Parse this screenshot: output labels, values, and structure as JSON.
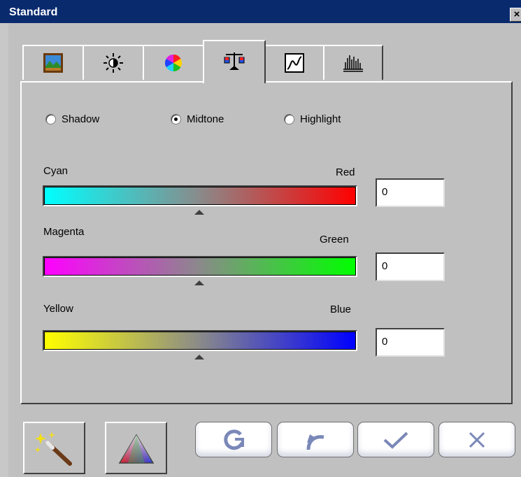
{
  "window": {
    "title": "Standard",
    "close_glyph": "×"
  },
  "tabs": [
    {
      "name": "image-tab",
      "icon": "landscape-picture-icon",
      "active": false
    },
    {
      "name": "brightness-tab",
      "icon": "sun-icon",
      "active": false
    },
    {
      "name": "color-wheel-tab",
      "icon": "color-wheel-icon",
      "active": false
    },
    {
      "name": "color-balance-tab",
      "icon": "balance-scale-icon",
      "active": true
    },
    {
      "name": "curves-tab",
      "icon": "curve-icon",
      "active": false
    },
    {
      "name": "histogram-tab",
      "icon": "histogram-icon",
      "active": false
    }
  ],
  "tone": {
    "options": [
      "Shadow",
      "Midtone",
      "Highlight"
    ],
    "selected": "Midtone"
  },
  "sliders": [
    {
      "left_label": "Cyan",
      "right_label": "Red",
      "value": "0",
      "left_color": "#00ffff",
      "right_color": "#ff0000"
    },
    {
      "left_label": "Magenta",
      "right_label": "Green",
      "value": "0",
      "left_color": "#ff00ff",
      "right_color": "#00ff00"
    },
    {
      "left_label": "Yellow",
      "right_label": "Blue",
      "value": "0",
      "left_color": "#ffff00",
      "right_color": "#0000ff"
    }
  ],
  "buttons": [
    {
      "name": "auto-fix-button",
      "icon": "magic-wand-icon"
    },
    {
      "name": "rgb-button",
      "icon": "rgb-triangle-icon"
    },
    {
      "name": "refresh-button",
      "icon": "refresh-icon"
    },
    {
      "name": "undo-button",
      "icon": "undo-icon"
    },
    {
      "name": "ok-button",
      "icon": "checkmark-icon"
    },
    {
      "name": "cancel-button",
      "icon": "x-icon"
    }
  ],
  "colors": {
    "title_bar": "#0a2a6e",
    "window": "#c0c0c0",
    "button_glyph": "#7a88b8"
  }
}
